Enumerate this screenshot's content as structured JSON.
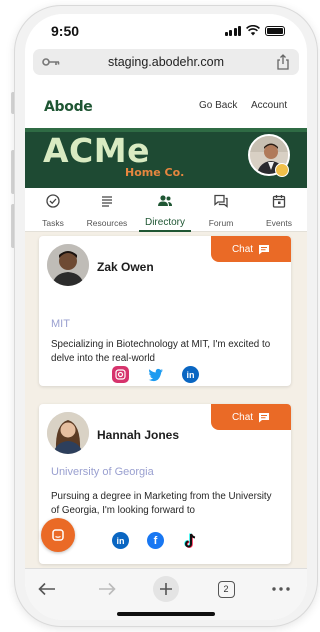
{
  "status_bar": {
    "time": "9:50"
  },
  "browser": {
    "url": "staging.abodehr.com",
    "tab_count": "2"
  },
  "site_header": {
    "logo": "Abode",
    "nav": [
      "Go Back",
      "Account"
    ]
  },
  "banner": {
    "title": "ACMe",
    "subtitle": "Home Co."
  },
  "tabs": [
    {
      "label": "Tasks",
      "icon": "check-circle-icon"
    },
    {
      "label": "Resources",
      "icon": "list-icon"
    },
    {
      "label": "Directory",
      "icon": "people-icon",
      "active": true
    },
    {
      "label": "Forum",
      "icon": "forum-icon"
    },
    {
      "label": "Events",
      "icon": "calendar-icon"
    }
  ],
  "directory": [
    {
      "name": "Zak Owen",
      "school": "MIT",
      "bio": "Specializing in Biotechnology at MIT, I'm excited to delve into the real-world",
      "chat_label": "Chat",
      "socials": [
        "instagram-icon",
        "twitter-icon",
        "linkedin-icon"
      ]
    },
    {
      "name": "Hannah Jones",
      "school": "University of Georgia",
      "bio": "Pursuing a degree in Marketing from the University of Georgia, I'm looking forward to",
      "chat_label": "Chat",
      "socials": [
        "linkedin-icon",
        "facebook-icon",
        "tiktok-icon"
      ]
    }
  ],
  "colors": {
    "brand_green": "#1f5633",
    "banner_green": "#1e4a33",
    "accent_orange": "#ea6a26",
    "content_bg": "#f4efe6",
    "school_text": "#9aa0d0"
  }
}
